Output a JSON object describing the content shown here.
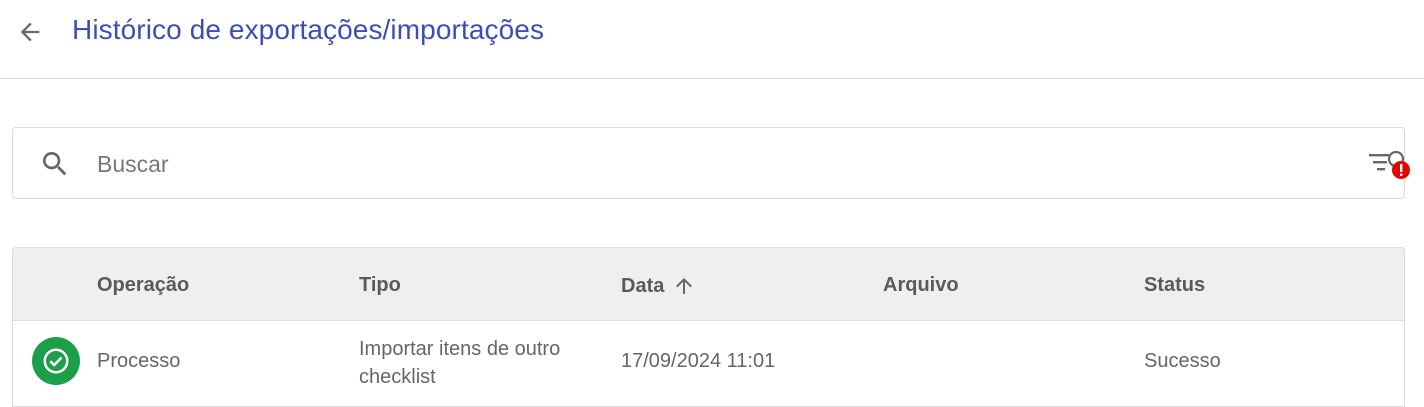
{
  "header": {
    "title": "Histórico de exportações/importações",
    "back_icon": "arrow-left-icon"
  },
  "search": {
    "placeholder": "Buscar",
    "value": "",
    "filter_icon": "filter-alert-icon",
    "alert_color": "#e60000"
  },
  "table": {
    "columns": [
      "Operação",
      "Tipo",
      "Data",
      "Arquivo",
      "Status"
    ],
    "sorted_column": "Data",
    "sort_direction": "ascending",
    "rows": [
      {
        "status_icon": "check-circle-icon",
        "status_color": "#1c9e4b",
        "operacao": "Processo",
        "tipo_line1": "Importar itens de outro",
        "tipo_line2": "checklist",
        "data": "17/09/2024 11:01",
        "arquivo": "",
        "status": "Sucesso"
      }
    ]
  },
  "colors": {
    "title": "#3f4eb5",
    "header_bg": "#efefef"
  }
}
